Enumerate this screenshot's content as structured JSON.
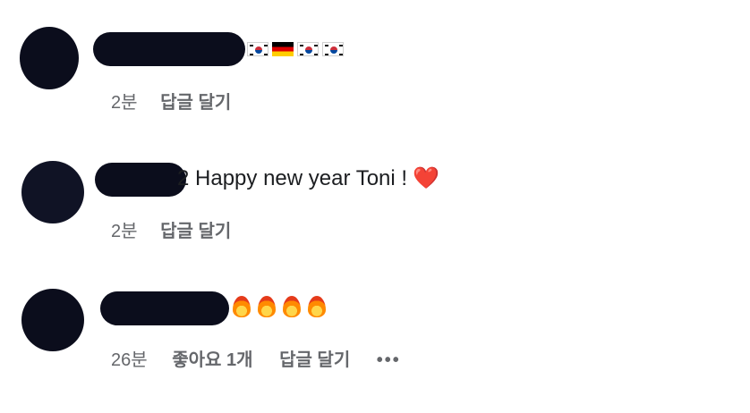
{
  "comments": [
    {
      "emoji_row": [
        "south-korea-flag-icon",
        "germany-flag-icon",
        "south-korea-flag-icon",
        "south-korea-flag-icon"
      ],
      "time": "2분",
      "reply": "답글 달기"
    },
    {
      "text_prefix": "2",
      "text": "Happy new year Toni !",
      "emoji": "❤️",
      "time": "2분",
      "reply": "답글 달기"
    },
    {
      "emoji_row": [
        "fire-icon",
        "fire-icon",
        "fire-icon",
        "fire-icon"
      ],
      "time": "26분",
      "likes": "좋아요 1개",
      "reply": "답글 달기",
      "more": "•••"
    }
  ]
}
